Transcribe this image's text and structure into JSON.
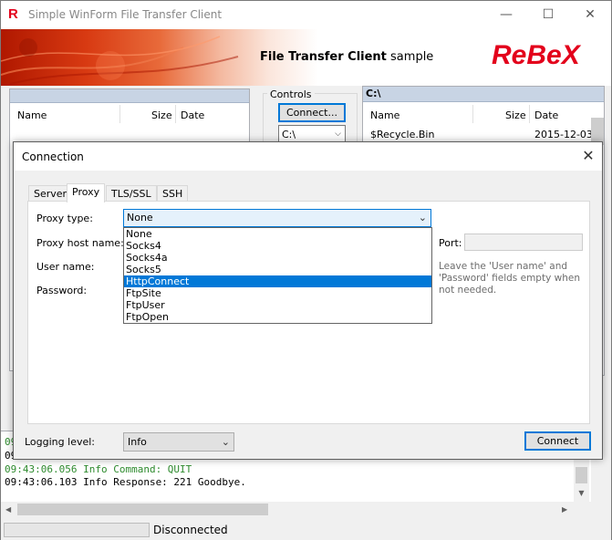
{
  "window": {
    "title": "Simple WinForm File Transfer Client",
    "min_glyph": "—",
    "max_glyph": "☐",
    "close_glyph": "✕"
  },
  "banner": {
    "title_bold": "File Transfer Client",
    "title_normal": " sample",
    "logo": "ReBeX"
  },
  "left_pane": {
    "columns": [
      "Name",
      "Size",
      "Date"
    ]
  },
  "controls": {
    "group_label": "Controls",
    "connect_label": "Connect...",
    "drive_value": "C:\\"
  },
  "right_pane": {
    "path": "C:\\",
    "columns": [
      "Name",
      "Size",
      "Date"
    ],
    "rows": [
      {
        "name": "$Recycle.Bin",
        "size": "",
        "date": "2015-12-03"
      }
    ]
  },
  "log": {
    "lines": [
      {
        "text": "09:43:06.056 Info Command: QUIT",
        "color": "#2e8b2e"
      },
      {
        "text": "09:43:06.103 Info Response: 221 Goodbye.",
        "color": "#000000"
      }
    ],
    "partial_prefix_1": "09",
    "partial_prefix_2": "09"
  },
  "status": {
    "text": "Disconnected",
    "progress": 0
  },
  "dialog": {
    "title": "Connection",
    "close_glyph": "✕",
    "tabs": [
      {
        "label": "Server",
        "active": false
      },
      {
        "label": "Proxy",
        "active": true
      },
      {
        "label": "TLS/SSL",
        "active": false
      },
      {
        "label": "SSH",
        "active": false
      }
    ],
    "labels": {
      "proxy_type": "Proxy type:",
      "proxy_host": "Proxy host name:",
      "user_name": "User name:",
      "password": "Password:",
      "port": "Port:"
    },
    "proxy_type_value": "None",
    "proxy_options": [
      "None",
      "Socks4",
      "Socks4a",
      "Socks5",
      "HttpConnect",
      "FtpSite",
      "FtpUser",
      "FtpOpen"
    ],
    "highlighted_option": "HttpConnect",
    "hint": "Leave the 'User name' and 'Password' fields empty when not needed.",
    "logging_label": "Logging level:",
    "logging_value": "Info",
    "connect_label": "Connect"
  },
  "colors": {
    "accent": "#0078d7",
    "brand_red": "#e3001b"
  }
}
